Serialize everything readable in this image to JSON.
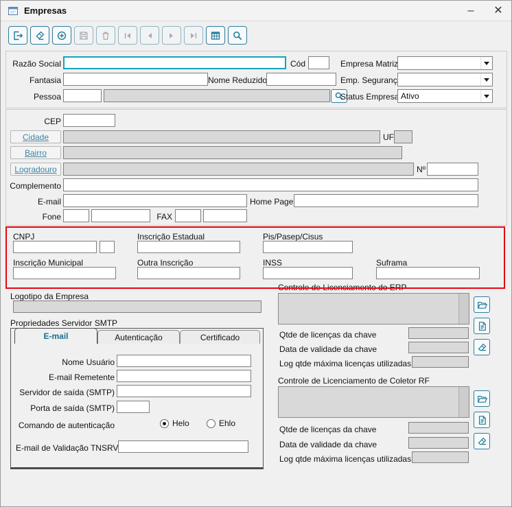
{
  "window": {
    "title": "Empresas",
    "minimize_glyph": "–",
    "close_glyph": "✕"
  },
  "colors": {
    "accent_icon": "#1f7a99",
    "disabled_icon": "#a8adb0",
    "focus_border": "#17a2b5",
    "annotation_red": "#e30613",
    "link_text": "#3a84a0"
  },
  "toolbar": {
    "buttons": [
      {
        "name": "exit",
        "enabled": true
      },
      {
        "name": "clear",
        "enabled": true
      },
      {
        "name": "add",
        "enabled": true
      },
      {
        "name": "save",
        "enabled": false
      },
      {
        "name": "delete",
        "enabled": false
      },
      {
        "name": "first-record",
        "enabled": false
      },
      {
        "name": "previous-record",
        "enabled": false
      },
      {
        "name": "next-record",
        "enabled": false
      },
      {
        "name": "last-record",
        "enabled": false
      },
      {
        "name": "grid-view",
        "enabled": true
      },
      {
        "name": "search",
        "enabled": true
      }
    ]
  },
  "identification": {
    "razao_social_label": "Razão Social",
    "cod_label": "Cód",
    "empresa_matriz_label": "Empresa Matriz",
    "empresa_matriz_value": "",
    "fantasia_label": "Fantasia",
    "nome_reduzido_label": "Nome Reduzido",
    "emp_seguranca_label": "Emp. Segurança",
    "emp_seguranca_value": "",
    "pessoa_label": "Pessoa",
    "status_empresa_label": "Status Empresa",
    "status_empresa_value": "Ativo"
  },
  "address": {
    "cep_label": "CEP",
    "cidade_label": "Cidade",
    "uf_label": "UF",
    "bairro_label": "Bairro",
    "logradouro_label": "Logradouro",
    "numero_label": "Nº",
    "complemento_label": "Complemento",
    "email_label": "E-mail",
    "homepage_label": "Home Page",
    "fone_label": "Fone",
    "fax_label": "FAX"
  },
  "fiscal": {
    "cnpj_label": "CNPJ",
    "inscricao_estadual_label": "Inscrição Estadual",
    "pis_label": "Pis/Pasep/Cisus",
    "inscricao_municipal_label": "Inscrição Municipal",
    "outra_inscricao_label": "Outra Inscrição",
    "inss_label": "INSS",
    "suframa_label": "Suframa"
  },
  "logotipo": {
    "title": "Logotipo da Empresa"
  },
  "smtp": {
    "title": "Propriedades Servidor SMTP",
    "tabs": [
      {
        "label": "E-mail",
        "active": true
      },
      {
        "label": "Autenticação",
        "active": false
      },
      {
        "label": "Certificado",
        "active": false
      }
    ],
    "nome_usuario_label": "Nome Usuário",
    "email_remetente_label": "E-mail Remetente",
    "servidor_saida_label": "Servidor de saída (SMTP)",
    "porta_saida_label": "Porta de saída (SMTP)",
    "comando_label": "Comando de autenticação",
    "radio_helo": "Helo",
    "radio_ehlo": "Ehlo",
    "helo_selected": true,
    "email_validacao_label": "E-mail de Validação TNSRV"
  },
  "erp_license": {
    "title": "Controle de Licenciamento do ERP",
    "qtde_label": "Qtde de licenças da chave",
    "validade_label": "Data de validade da chave",
    "log_label": "Log qtde máxima licenças utilizadas"
  },
  "rf_license": {
    "title": "Controle de Licenciamento de Coletor RF",
    "qtde_label": "Qtde de licenças da chave",
    "validade_label": "Data de validade da chave",
    "log_label": "Log qtde máxima licenças utilizadas"
  }
}
